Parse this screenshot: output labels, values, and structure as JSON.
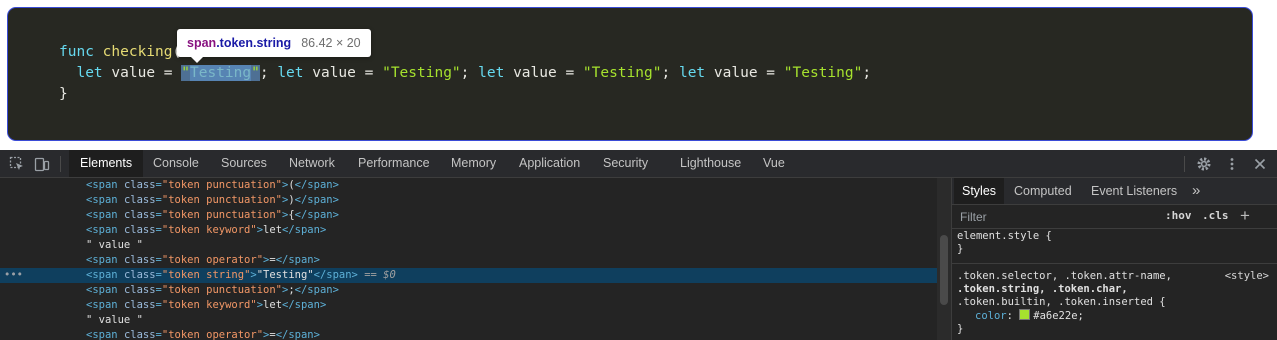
{
  "preview": {
    "code_lines": [
      {
        "func_kw": "func",
        "func_name": "checking",
        "paren": "("
      },
      {
        "let": "let",
        "var": "value",
        "eq": "=",
        "str_open": "\"",
        "str_body": "Testing",
        "str_close": "\"",
        "semi": ";"
      }
    ],
    "repeat_statement": {
      "let": "let",
      "rest": " value = ",
      "str": "\"Testing\"",
      "semi": ";"
    },
    "closing_brace": "}",
    "tooltip": {
      "tag": "span",
      "classes": ".token.string",
      "dimensions": "86.42 × 20"
    }
  },
  "devtools": {
    "tabs": [
      "Elements",
      "Console",
      "Sources",
      "Network",
      "Performance",
      "Memory",
      "Application",
      "Security",
      "Lighthouse",
      "Vue"
    ],
    "active_tab": "Elements",
    "elements_rows": [
      {
        "kind": "span",
        "class": "token punctuation",
        "text": "("
      },
      {
        "kind": "span",
        "class": "token punctuation",
        "text": ")"
      },
      {
        "kind": "span",
        "class": "token punctuation",
        "text": "{"
      },
      {
        "kind": "span",
        "class": "token keyword",
        "text": "let"
      },
      {
        "kind": "text",
        "text": "\" value \""
      },
      {
        "kind": "span",
        "class": "token operator",
        "text": "="
      },
      {
        "kind": "span",
        "class": "token string",
        "text": "\"Testing\"",
        "selected": true,
        "suffix": " == $0"
      },
      {
        "kind": "span",
        "class": "token punctuation",
        "text": ";"
      },
      {
        "kind": "span",
        "class": "token keyword",
        "text": "let"
      },
      {
        "kind": "text",
        "text": "\" value \""
      },
      {
        "kind": "span",
        "class": "token operator",
        "text": "="
      }
    ],
    "selected_row_dots": "•••",
    "styles_tabs": [
      "Styles",
      "Computed",
      "Event Listeners"
    ],
    "styles_more": "»",
    "filter_placeholder": "Filter",
    "hov_label": ":hov",
    "cls_label": ".cls",
    "add_rule": "+",
    "element_style": {
      "selector": "element.style {",
      "close": "}"
    },
    "token_rule": {
      "selector_line1": ".token.selector, .token.attr-name,",
      "selector_line2": ".token.string, .token.char,",
      "selector_line3": ".token.builtin, .token.inserted {",
      "source": "<style>",
      "property": "color",
      "value": "#a6e22e",
      "close": "}"
    }
  },
  "colors": {
    "swatch": "#a6e22e",
    "selection": "#0f3f5e",
    "code_bg": "#272822"
  }
}
